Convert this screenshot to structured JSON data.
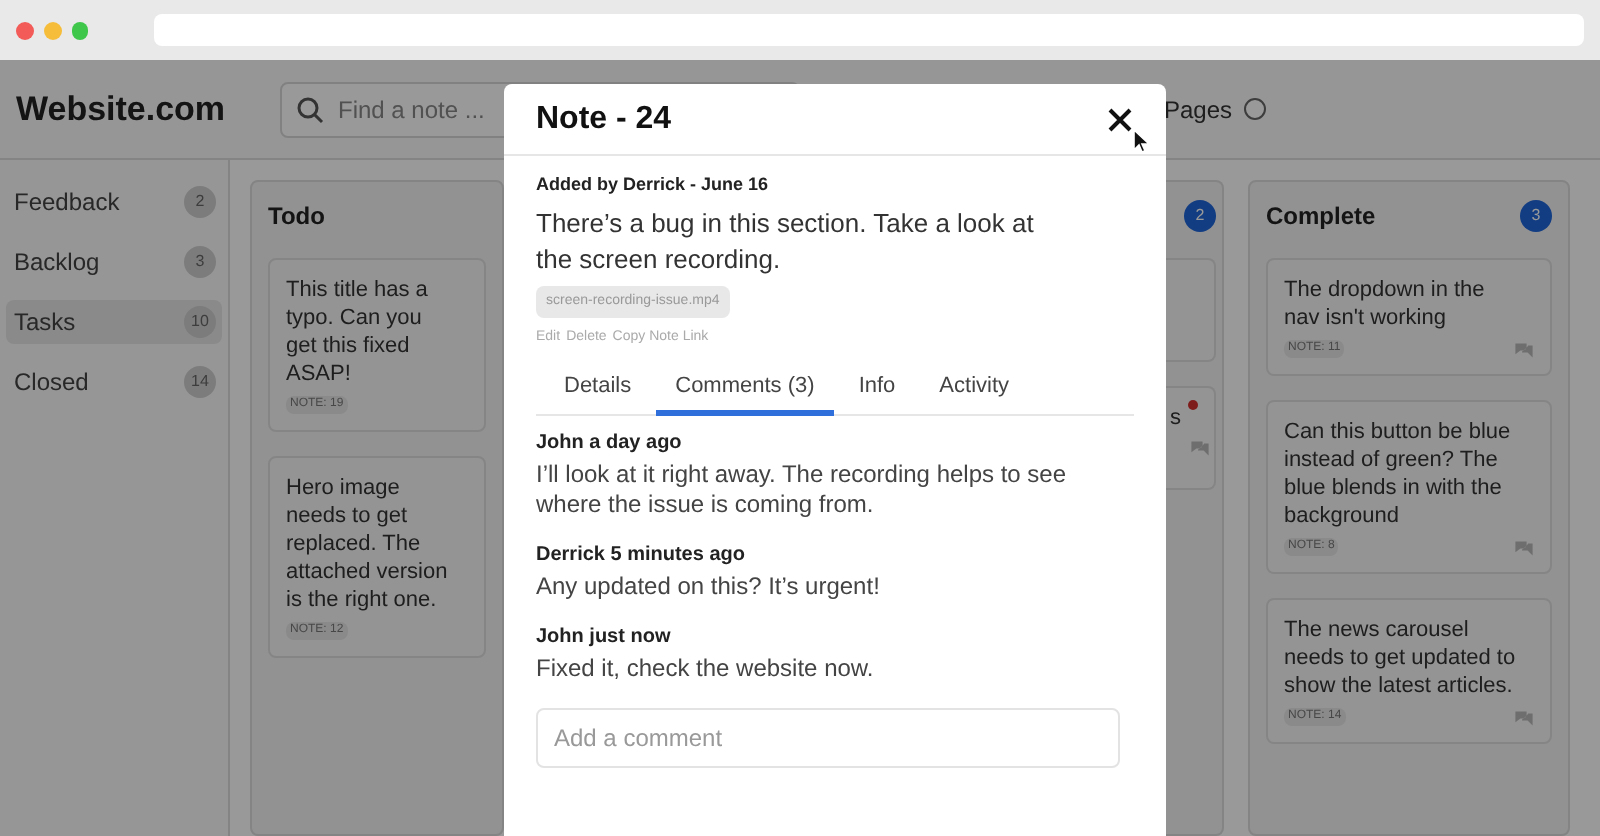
{
  "app": {
    "brand": "Website.com",
    "search": {
      "placeholder": "Find a note ..."
    },
    "pages_toggle": {
      "label": "Pages",
      "on": false
    }
  },
  "sidebar": {
    "items": [
      {
        "label": "Feedback",
        "count": "2",
        "selected": false
      },
      {
        "label": "Backlog",
        "count": "3",
        "selected": false
      },
      {
        "label": "Tasks",
        "count": "10",
        "selected": true
      },
      {
        "label": "Closed",
        "count": "14",
        "selected": false
      }
    ]
  },
  "board": {
    "columns": [
      {
        "title": "Todo",
        "cards": [
          {
            "text": "This title has a typo. Can you get this fixed ASAP!",
            "note": "NOTE: 19",
            "comments": false,
            "unread": false
          },
          {
            "text": "Hero image needs to get replaced. The attached version is the right one.",
            "note": "NOTE: 12",
            "comments": false,
            "unread": false
          }
        ]
      },
      {
        "count": "2",
        "cards": [
          {
            "comments": false,
            "unread": false
          },
          {
            "text": "s",
            "comments": true,
            "unread": true
          }
        ]
      },
      {
        "title": "Complete",
        "count": "3",
        "cards": [
          {
            "text": "The dropdown in the nav isn't working",
            "note": "NOTE: 11",
            "comments": true,
            "unread": false
          },
          {
            "text": "Can this button be blue instead of green? The blue blends in with the background",
            "note": "NOTE: 8",
            "comments": true,
            "unread": false
          },
          {
            "text": "The news carousel needs to get updated to show the latest articles.",
            "note": "NOTE: 14",
            "comments": true,
            "unread": false
          }
        ]
      }
    ]
  },
  "modal": {
    "title": "Note - 24",
    "meta": "Added by Derrick - June 16",
    "description": "There’s a bug in this section. Take a look at the screen recording.",
    "attachment": "screen-recording-issue.mp4",
    "actions": [
      "Edit",
      "Delete",
      "Copy Note Link"
    ],
    "tabs": [
      {
        "label": "Details",
        "selected": false
      },
      {
        "label": "Comments (3)",
        "selected": true
      },
      {
        "label": "Info",
        "selected": false
      },
      {
        "label": "Activity",
        "selected": false
      }
    ],
    "comments": [
      {
        "heading": "John a day ago",
        "text": "I’ll look at it right away. The recording helps to see where the issue is coming from."
      },
      {
        "heading": "Derrick 5 minutes ago",
        "text": "Any updated on this? It’s urgent!"
      },
      {
        "heading": "John just now",
        "text": "Fixed it, check the website now."
      }
    ],
    "comment_field": {
      "placeholder": "Add a comment"
    }
  }
}
